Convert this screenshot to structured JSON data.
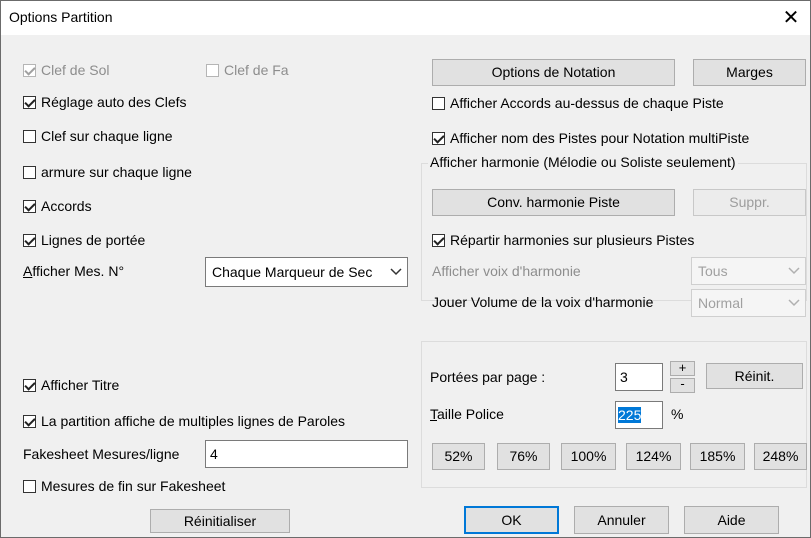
{
  "window": {
    "title": "Options Partition",
    "close_glyph": "✕"
  },
  "left": {
    "clef_sol": {
      "label": "Clef de Sol",
      "checked": true,
      "enabled": false
    },
    "clef_fa": {
      "label": "Clef de Fa",
      "checked": false,
      "enabled": false
    },
    "auto_clefs": {
      "label": "Réglage auto des Clefs",
      "checked": true
    },
    "clef_each_line": {
      "label": "Clef sur chaque ligne",
      "checked": false
    },
    "key_each_line": {
      "label": "armure sur chaque ligne",
      "checked": false
    },
    "chords": {
      "label": "Accords",
      "checked": true
    },
    "staff_lines": {
      "label": "Lignes de portée",
      "checked": true
    },
    "bar_numbers": {
      "label_first": "A",
      "label_rest": "fficher Mes. N°",
      "value": "Chaque Marqueur de Sec"
    },
    "show_title": {
      "label": "Afficher Titre",
      "checked": true
    },
    "multi_lyrics": {
      "label": "La partition affiche de multiples lignes de Paroles",
      "checked": true
    },
    "fakesheet": {
      "label": "Fakesheet Mesures/ligne",
      "value": "4"
    },
    "end_bars": {
      "label": "Mesures de fin sur Fakesheet",
      "checked": false
    },
    "reset_button": "Réinitialiser"
  },
  "right": {
    "notation_button": "Options de Notation",
    "margins_button": "Marges",
    "chords_above": {
      "label": "Afficher Accords au-dessus de chaque Piste",
      "checked": false
    },
    "track_names": {
      "label": "Afficher nom des Pistes pour Notation multiPiste",
      "checked": true
    },
    "harmony": {
      "heading": "Afficher harmonie (Mélodie ou Soliste seulement)",
      "convert_button": "Conv. harmonie Piste",
      "delete_button": "Suppr.",
      "split": {
        "label": "Répartir harmonies sur plusieurs Pistes",
        "checked": true
      },
      "voice_label": "Afficher voix d'harmonie",
      "voice_value": "Tous",
      "volume_label": "Jouer Volume de la voix d'harmonie",
      "volume_value": "Normal"
    },
    "staves": {
      "label": "Portées par page :",
      "value": "3",
      "plus": "+",
      "minus": "-",
      "reset_button": "Réinit."
    },
    "font": {
      "label_first": "T",
      "label_rest": "aille Police",
      "value": "225",
      "unit": "%",
      "presets": [
        "52%",
        "76%",
        "100%",
        "124%",
        "185%",
        "248%"
      ]
    }
  },
  "footer": {
    "ok": "OK",
    "cancel": "Annuler",
    "help": "Aide"
  }
}
